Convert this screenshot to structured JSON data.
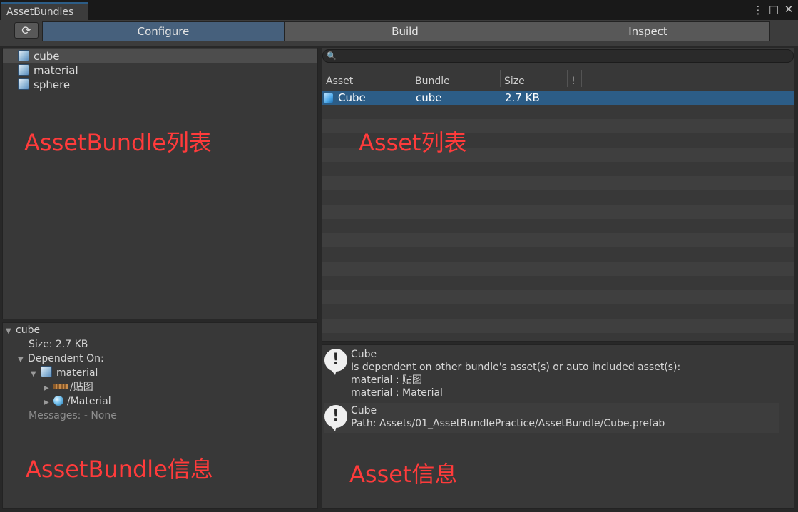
{
  "window": {
    "tab_title": "AssetBundles",
    "menu_icon": "⋮",
    "maximize_icon": "□",
    "close_icon": "✕"
  },
  "toolbar": {
    "refresh_icon": "⟳",
    "tabs": [
      {
        "label": "Configure",
        "active": true
      },
      {
        "label": "Build",
        "active": false
      },
      {
        "label": "Inspect",
        "active": false
      }
    ]
  },
  "bundle_list": {
    "items": [
      {
        "label": "cube",
        "selected": true
      },
      {
        "label": "material",
        "selected": false
      },
      {
        "label": "sphere",
        "selected": false
      }
    ],
    "annotation": "AssetBundle列表"
  },
  "asset_list": {
    "search_icon": "🔍",
    "columns": [
      "Asset",
      "Bundle",
      "Size",
      "!"
    ],
    "rows": [
      {
        "asset": "Cube",
        "bundle": "cube",
        "size": "2.7 KB",
        "selected": true
      }
    ],
    "annotation": "Asset列表"
  },
  "bundle_info": {
    "root": "cube",
    "size": "Size: 2.7 KB",
    "dependent_on": "Dependent On:",
    "dependency": "material",
    "children": [
      "/贴图",
      "/Material"
    ],
    "messages": "Messages: - None",
    "annotation": "AssetBundle信息"
  },
  "asset_info": {
    "messages": [
      {
        "lines": [
          "Cube",
          "Is dependent on other bundle's asset(s) or auto included asset(s):",
          "material : 贴图",
          "material : Material"
        ]
      },
      {
        "lines": [
          "Cube",
          "Path: Assets/01_AssetBundlePractice/AssetBundle/Cube.prefab"
        ]
      }
    ],
    "annotation": "Asset信息"
  },
  "colors": {
    "accent_selected": "#2c5d87",
    "active_tab": "#46607c",
    "annotation_red": "#ff3b3b"
  }
}
